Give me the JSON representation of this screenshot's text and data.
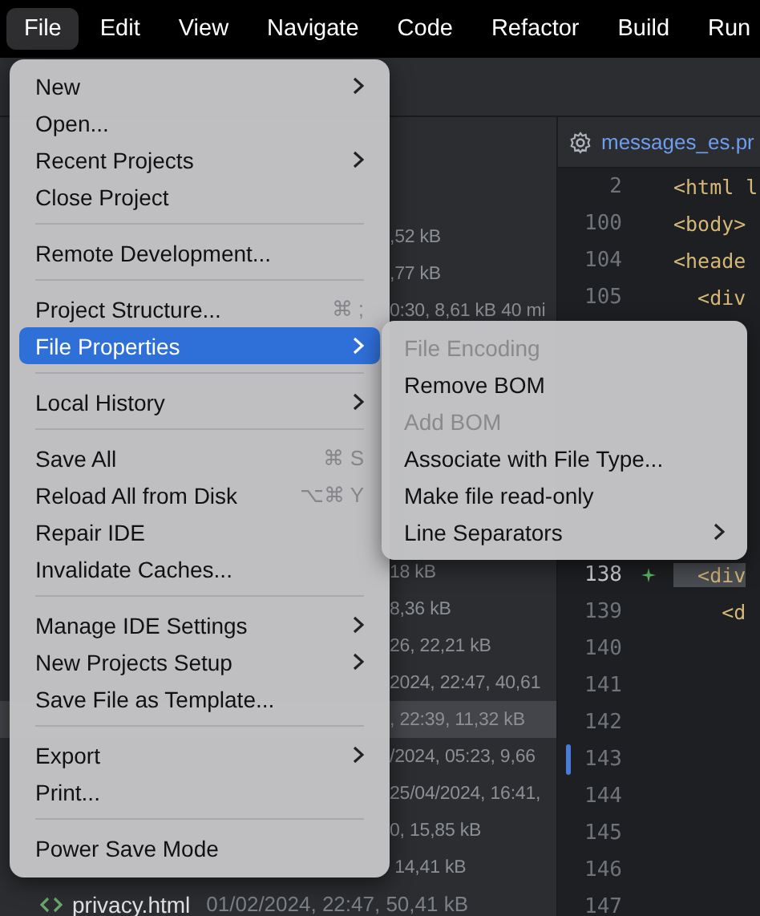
{
  "menu_bar": [
    {
      "label": "File",
      "selected": true
    },
    {
      "label": "Edit",
      "selected": false
    },
    {
      "label": "View",
      "selected": false
    },
    {
      "label": "Navigate",
      "selected": false
    },
    {
      "label": "Code",
      "selected": false
    },
    {
      "label": "Refactor",
      "selected": false
    },
    {
      "label": "Build",
      "selected": false
    },
    {
      "label": "Run",
      "selected": false
    }
  ],
  "file_list": {
    "rows_top": [
      {
        "meta": ",52 kB",
        "selected": false
      },
      {
        "meta": ",77 kB",
        "selected": false
      },
      {
        "meta": "0:30, 8,61 kB 40 mi",
        "selected": false
      }
    ],
    "rows_bottom": [
      {
        "meta": "18 kB",
        "selected": false
      },
      {
        "meta": "8,36 kB",
        "selected": false
      },
      {
        "meta": "26, 22,21 kB",
        "selected": false
      },
      {
        "meta": "2024, 22:47, 40,61",
        "selected": false
      },
      {
        "meta": ", 22:39, 11,32 kB",
        "selected": true
      },
      {
        "meta": "/2024, 05:23, 9,66",
        "selected": false
      },
      {
        "meta": "25/04/2024, 16:41,",
        "selected": false
      },
      {
        "meta": "0, 15,85 kB",
        "selected": false
      },
      {
        "meta": " 14,41 kB",
        "selected": false
      }
    ],
    "last_row": {
      "name": "privacy.html",
      "meta": "01/02/2024, 22:47, 50,41 kB"
    }
  },
  "editor": {
    "tab": {
      "title": "messages_es.pr"
    },
    "lines_top": [
      {
        "number": "2",
        "code": "<html l",
        "matched": false
      },
      {
        "number": "100",
        "code": "<body>",
        "matched": false
      },
      {
        "number": "104",
        "code": "<heade",
        "matched": false
      },
      {
        "number": "105",
        "code": "  <div",
        "matched": false
      }
    ],
    "lines_bottom": [
      {
        "number": "138",
        "code": "  <div",
        "matched": true,
        "added": true,
        "modified": false
      },
      {
        "number": "139",
        "code": "    <d",
        "matched": false,
        "added": false,
        "modified": false
      },
      {
        "number": "140",
        "added": false,
        "modified": false
      },
      {
        "number": "141",
        "added": false,
        "modified": false
      },
      {
        "number": "142",
        "added": false,
        "modified": false
      },
      {
        "number": "143",
        "added": false,
        "modified": true
      },
      {
        "number": "144",
        "added": false,
        "modified": false
      },
      {
        "number": "145",
        "added": false,
        "modified": false
      },
      {
        "number": "146",
        "added": false,
        "modified": false
      },
      {
        "number": "147",
        "added": false,
        "modified": false
      }
    ]
  },
  "file_menu": {
    "groups": [
      [
        {
          "label": "New",
          "submenu": true,
          "selected": false
        },
        {
          "label": "Open...",
          "submenu": false,
          "selected": false
        },
        {
          "label": "Recent Projects",
          "submenu": true,
          "selected": false
        },
        {
          "label": "Close Project",
          "submenu": false,
          "selected": false
        }
      ],
      [
        {
          "label": "Remote Development...",
          "submenu": false,
          "selected": false
        }
      ],
      [
        {
          "label": "Project Structure...",
          "shortcut": "⌘ ;",
          "submenu": false,
          "selected": false
        },
        {
          "label": "File Properties",
          "submenu": true,
          "selected": true
        }
      ],
      [
        {
          "label": "Local History",
          "submenu": true,
          "selected": false
        }
      ],
      [
        {
          "label": "Save All",
          "shortcut": "⌘ S",
          "submenu": false,
          "selected": false
        },
        {
          "label": "Reload All from Disk",
          "shortcut": "⌥⌘ Y",
          "submenu": false,
          "selected": false
        },
        {
          "label": "Repair IDE",
          "submenu": false,
          "selected": false
        },
        {
          "label": "Invalidate Caches...",
          "submenu": false,
          "selected": false
        }
      ],
      [
        {
          "label": "Manage IDE Settings",
          "submenu": true,
          "selected": false
        },
        {
          "label": "New Projects Setup",
          "submenu": true,
          "selected": false
        },
        {
          "label": "Save File as Template...",
          "submenu": false,
          "selected": false
        }
      ],
      [
        {
          "label": "Export",
          "submenu": true,
          "selected": false
        },
        {
          "label": "Print...",
          "submenu": false,
          "selected": false
        }
      ],
      [
        {
          "label": "Power Save Mode",
          "submenu": false,
          "selected": false
        }
      ]
    ]
  },
  "submenu": {
    "items": [
      {
        "label": "File Encoding",
        "disabled": true,
        "submenu": false
      },
      {
        "label": "Remove BOM",
        "disabled": false,
        "submenu": false
      },
      {
        "label": "Add BOM",
        "disabled": true,
        "submenu": false
      },
      {
        "label": "Associate with File Type...",
        "disabled": false,
        "submenu": false
      },
      {
        "label": "Make file read-only",
        "disabled": false,
        "submenu": false
      },
      {
        "label": "Line Separators",
        "disabled": false,
        "submenu": true
      }
    ]
  }
}
